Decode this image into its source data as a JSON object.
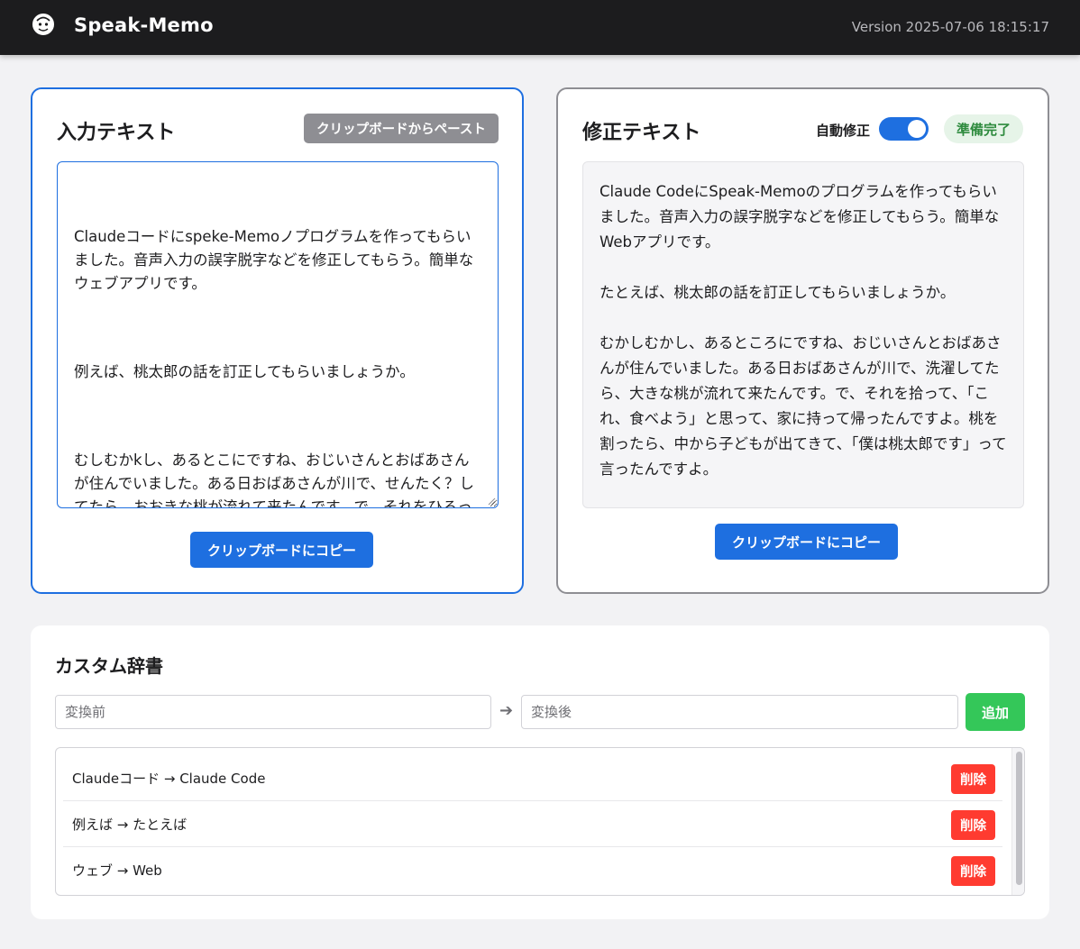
{
  "header": {
    "title": "Speak-Memo",
    "version": "Version 2025-07-06 18:15:17"
  },
  "input_panel": {
    "title": "入力テキスト",
    "paste_label": "クリップボードからペースト",
    "paragraphs": [
      "Claudeコードにspeke-Memoノプログラムを作ってもらいました。音声入力の誤字脱字などを修正してもらう。簡単なウェブアプリです。",
      "例えば、桃太郎の話を訂正してもらいましょうか。",
      "むしむかkし、あるとこにですね、おじいさんとおばあさんが住んでいました。ある日おばあさんが川で、せんたく？してたら、おおきな桃が流れて来たんです。で、それをひろって、「これ、た食べよう」: と思って、いえに持ってかえったんですよ。ももをわったra,中から子どもが出てきて、「ぼくわ桃太郎です」って言ったんですよ。"
    ],
    "copy_label": "クリップボードにコピー"
  },
  "output_panel": {
    "title": "修正テキスト",
    "auto_fix_label": "自動修正",
    "auto_fix_on": true,
    "status": "準備完了",
    "paragraphs": [
      "Claude CodeにSpeak-Memoのプログラムを作ってもらいました。音声入力の誤字脱字などを修正してもらう。簡単なWebアプリです。",
      "たとえば、桃太郎の話を訂正してもらいましょうか。",
      "むかしむかし、あるところにですね、おじいさんとおばあさんが住んでいました。ある日おばあさんが川で、洗濯してたら、大きな桃が流れて来たんです。で、それを拾って、「これ、食べよう」と思って、家に持って帰ったんですよ。桃を割ったら、中から子どもが出てきて、「僕は桃太郎です」って言ったんですよ。"
    ],
    "copy_label": "クリップボードにコピー"
  },
  "dictionary": {
    "title": "カスタム辞書",
    "before_placeholder": "変換前",
    "after_placeholder": "変換後",
    "add_label": "追加",
    "entries": [
      {
        "text": "Claudeコード → Claude Code",
        "delete_label": "削除"
      },
      {
        "text": "例えば → たとえば",
        "delete_label": "削除"
      },
      {
        "text": "ウェブ → Web",
        "delete_label": "削除"
      }
    ]
  },
  "colors": {
    "accent": "#1e6fe0",
    "success": "#34c759",
    "danger": "#ff3b30",
    "header_bg": "#1c1c1e"
  }
}
